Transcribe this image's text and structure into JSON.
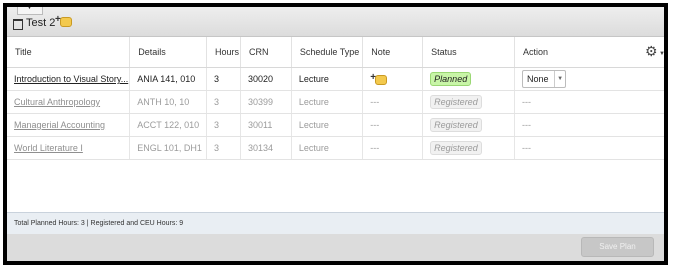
{
  "plan": {
    "name": "Test 2"
  },
  "columns": [
    "Title",
    "Details",
    "Hours",
    "CRN",
    "Schedule Type",
    "Note",
    "Status",
    "Action"
  ],
  "rows": [
    {
      "title": "Introduction to Visual Story...",
      "details": "ANIA 141, 010",
      "hours": "3",
      "crn": "30020",
      "schedule_type": "Lecture",
      "note": "",
      "status": "Planned",
      "action": "None"
    },
    {
      "title": "Cultural Anthropology",
      "details": "ANTH 10, 10",
      "hours": "3",
      "crn": "30399",
      "schedule_type": "Lecture",
      "note": "---",
      "status": "Registered",
      "action": "---"
    },
    {
      "title": "Managerial Accounting",
      "details": "ACCT 122, 010",
      "hours": "3",
      "crn": "30011",
      "schedule_type": "Lecture",
      "note": "---",
      "status": "Registered",
      "action": "---"
    },
    {
      "title": "World Literature I",
      "details": "ENGL 101, DH1",
      "hours": "3",
      "crn": "30134",
      "schedule_type": "Lecture",
      "note": "---",
      "status": "Registered",
      "action": "---"
    }
  ],
  "footer": {
    "summary": "Total Planned Hours: 3 | Registered and CEU Hours: 9"
  },
  "buttons": {
    "save_plan": "Save Plan"
  },
  "icons": {
    "calendar": "calendar-icon",
    "add_note": "add-note-icon",
    "settings": "gear-icon"
  },
  "colors": {
    "planned": "#c8f5a7",
    "footer": "#e9eef3"
  }
}
